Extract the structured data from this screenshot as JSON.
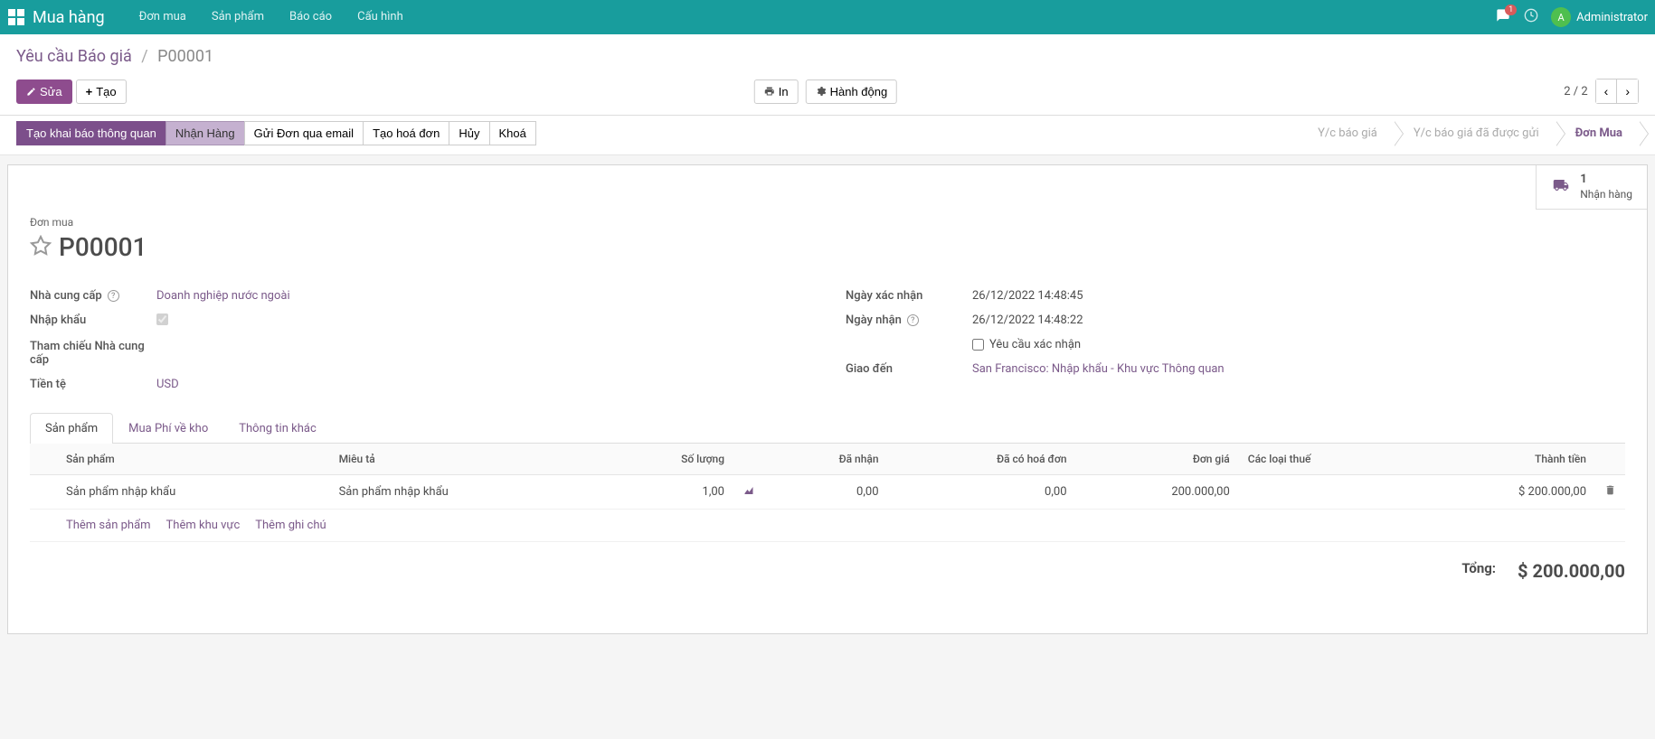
{
  "topbar": {
    "app_title": "Mua hàng",
    "nav": [
      "Đơn mua",
      "Sản phẩm",
      "Báo cáo",
      "Cấu hình"
    ],
    "chat_badge": "1",
    "user_initial": "A",
    "user_name": "Administrator"
  },
  "breadcrumb": {
    "root": "Yêu cầu Báo giá",
    "current": "P00001"
  },
  "ctrl": {
    "edit": "Sửa",
    "create": "Tạo",
    "print": "In",
    "action": "Hành động",
    "pager": "2 / 2"
  },
  "status": {
    "btn1": "Tạo khai báo thông quan",
    "btn2": "Nhận Hàng",
    "btn3": "Gửi Đơn qua email",
    "btn4": "Tạo hoá đơn",
    "btn5": "Hủy",
    "btn6": "Khoá",
    "steps": [
      "Y/c báo giá",
      "Y/c báo giá đã được gửi",
      "Đơn Mua"
    ]
  },
  "stat_button": {
    "count": "1",
    "label": "Nhận hàng"
  },
  "title": {
    "small": "Đơn mua",
    "name": "P00001"
  },
  "fields_left": {
    "supplier_label": "Nhà cung cấp",
    "supplier_value": "Doanh nghiệp nước ngoài",
    "import_label": "Nhập khẩu",
    "vendor_ref_label": "Tham chiếu Nhà cung cấp",
    "currency_label": "Tiền tệ",
    "currency_value": "USD"
  },
  "fields_right": {
    "confirmed_label": "Ngày xác nhận",
    "confirmed_value": "26/12/2022 14:48:45",
    "receipt_label": "Ngày nhận",
    "receipt_value": "26/12/2022 14:48:22",
    "ask_confirm_label": "Yêu cầu xác nhận",
    "deliver_to_label": "Giao đến",
    "deliver_to_value": "San Francisco: Nhập khẩu - Khu vực Thông quan"
  },
  "tabs": [
    "Sản phẩm",
    "Mua Phí về kho",
    "Thông tin khác"
  ],
  "table": {
    "headers": {
      "product": "Sản phẩm",
      "desc": "Miêu tả",
      "qty": "Số lượng",
      "received": "Đã nhận",
      "billed": "Đã có hoá đơn",
      "price": "Đơn giá",
      "taxes": "Các loại thuế",
      "subtotal": "Thành tiền"
    },
    "row": {
      "product": "Sản phẩm nhập khẩu",
      "desc": "Sản phẩm nhập khẩu",
      "qty": "1,00",
      "received": "0,00",
      "billed": "0,00",
      "price": "200.000,00",
      "taxes": "",
      "subtotal": "$ 200.000,00"
    },
    "add_product": "Thêm sản phẩm",
    "add_section": "Thêm khu vực",
    "add_note": "Thêm ghi chú"
  },
  "totals": {
    "label": "Tổng:",
    "amount": "$ 200.000,00"
  }
}
